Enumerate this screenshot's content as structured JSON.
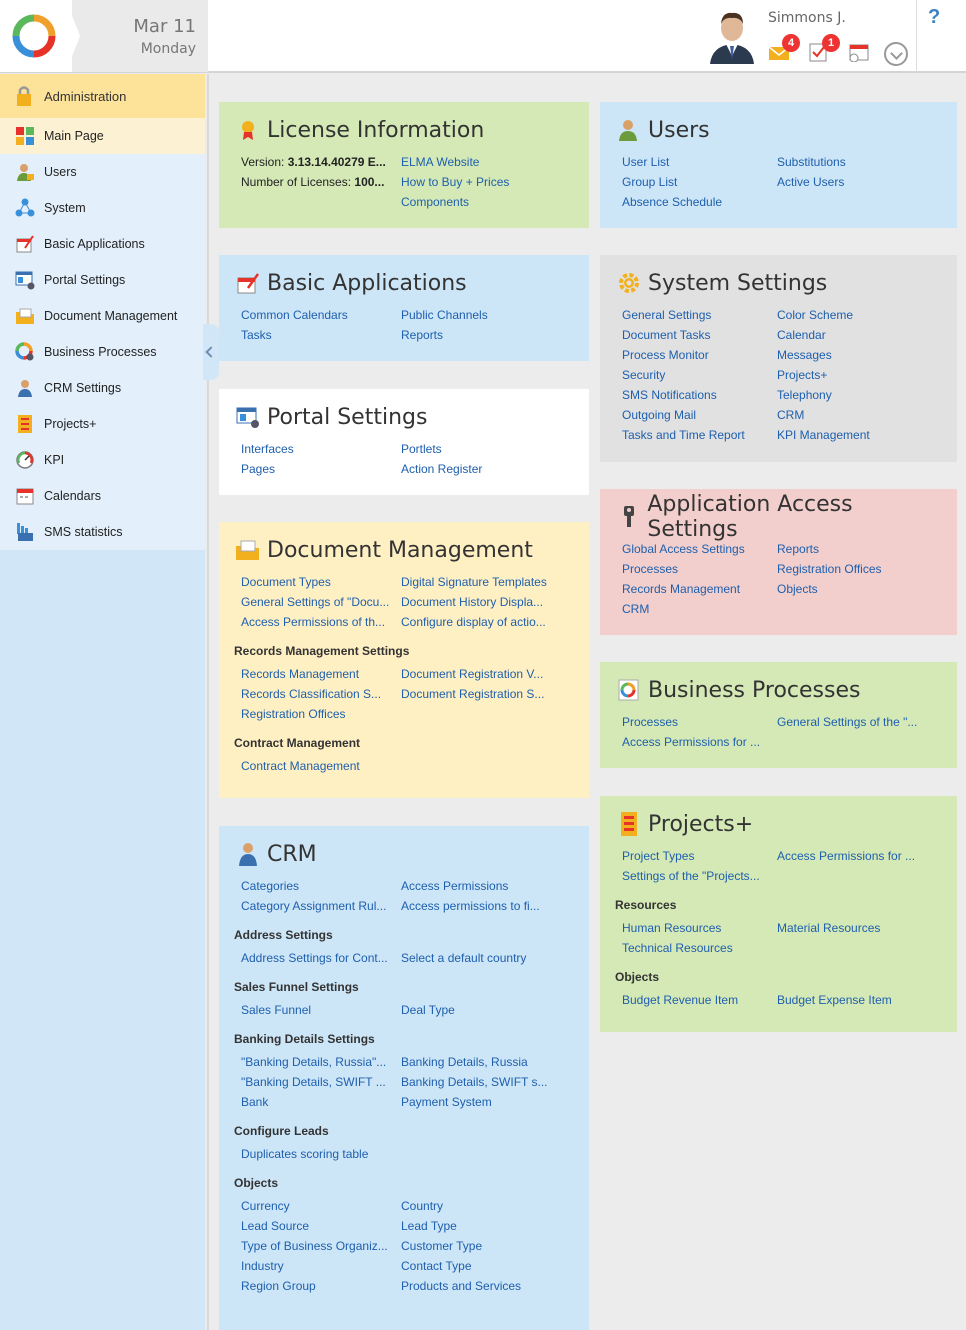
{
  "header": {
    "date": "Mar 11",
    "weekday": "Monday",
    "user_name": "Simmons J.",
    "mail_count": "4",
    "tasks_count": "1",
    "help": "?"
  },
  "sidebar": {
    "title": "Administration",
    "items": [
      {
        "label": "Main Page"
      },
      {
        "label": "Users"
      },
      {
        "label": "System"
      },
      {
        "label": "Basic Applications"
      },
      {
        "label": "Portal Settings"
      },
      {
        "label": "Document Management"
      },
      {
        "label": "Business Processes"
      },
      {
        "label": "CRM Settings"
      },
      {
        "label": "Projects+"
      },
      {
        "label": "KPI"
      },
      {
        "label": "Calendars"
      },
      {
        "label": "SMS statistics"
      }
    ]
  },
  "license": {
    "title": "License Information",
    "version_label": "Version: ",
    "version_value": "3.13.14.40279 E...",
    "licenses_label": "Number of Licenses: ",
    "licenses_value": "100...",
    "links": [
      "ELMA Website",
      "How to Buy + Prices",
      "Components"
    ]
  },
  "users": {
    "title": "Users",
    "left": [
      "User List",
      "Group List",
      "Absence Schedule"
    ],
    "right": [
      "Substitutions",
      "Active Users"
    ]
  },
  "basic_apps": {
    "title": "Basic Applications",
    "links": [
      "Common Calendars",
      "Public Channels",
      "Tasks",
      "Reports"
    ]
  },
  "system_settings": {
    "title": "System Settings",
    "links": [
      "General Settings",
      "Color Scheme",
      "Document Tasks",
      "Calendar",
      "Process Monitor",
      "Messages",
      "Security",
      "Projects+",
      "SMS Notifications",
      "Telephony",
      "Outgoing Mail",
      "CRM",
      "Tasks and Time Report",
      "KPI Management"
    ]
  },
  "portal_settings": {
    "title": "Portal Settings",
    "links": [
      "Interfaces",
      "Portlets",
      "Pages",
      "Action Register"
    ]
  },
  "doc_management": {
    "title": "Document Management",
    "links": [
      "Document Types",
      "Digital Signature Templates",
      "General Settings of \"Docu...",
      "Document History Displa...",
      "Access Permissions of th...",
      "Configure display of actio..."
    ],
    "records_title": "Records Management Settings",
    "records_links": [
      "Records Management",
      "Document Registration V...",
      "Records Classification S...",
      "Document Registration S...",
      "Registration Offices",
      ""
    ],
    "contract_title": "Contract Management",
    "contract_links": [
      "Contract Management"
    ]
  },
  "app_access": {
    "title": "Application Access Settings",
    "links": [
      "Global Access Settings",
      "Reports",
      "Processes",
      "Registration Offices",
      "Records Management",
      "Objects",
      "CRM",
      ""
    ]
  },
  "business_processes": {
    "title": "Business Processes",
    "links": [
      "Processes",
      "General Settings of the \"...",
      "Access Permissions for ...",
      ""
    ]
  },
  "crm": {
    "title": "CRM",
    "links": [
      "Categories",
      "Access Permissions",
      "Category Assignment Rul...",
      "Access permissions to fi..."
    ],
    "address_title": "Address Settings",
    "address_links": [
      "Address Settings for Cont...",
      "Select a default country"
    ],
    "funnel_title": "Sales Funnel Settings",
    "funnel_links": [
      "Sales Funnel",
      "Deal Type"
    ],
    "banking_title": "Banking Details Settings",
    "banking_links": [
      "\"Banking Details, Russia\"...",
      "Banking Details, Russia",
      "\"Banking Details, SWIFT ...",
      "Banking Details, SWIFT s...",
      "Bank",
      "Payment System"
    ],
    "leads_title": "Configure Leads",
    "leads_links": [
      "Duplicates scoring table"
    ],
    "objects_title": "Objects",
    "objects_links": [
      "Currency",
      "Country",
      "Lead Source",
      "Lead Type",
      "Type of Business Organiz...",
      "Customer Type",
      "Industry",
      "Contact Type",
      "Region Group",
      "Products and Services"
    ]
  },
  "projects": {
    "title": "Projects+",
    "links": [
      "Project Types",
      "Access Permissions for ...",
      "Settings of the \"Projects...",
      ""
    ],
    "resources_title": "Resources",
    "resources_links": [
      "Human Resources",
      "Material Resources",
      "Technical Resources",
      ""
    ],
    "objects_title": "Objects",
    "objects_links": [
      "Budget Revenue Item",
      "Budget Expense Item"
    ]
  }
}
